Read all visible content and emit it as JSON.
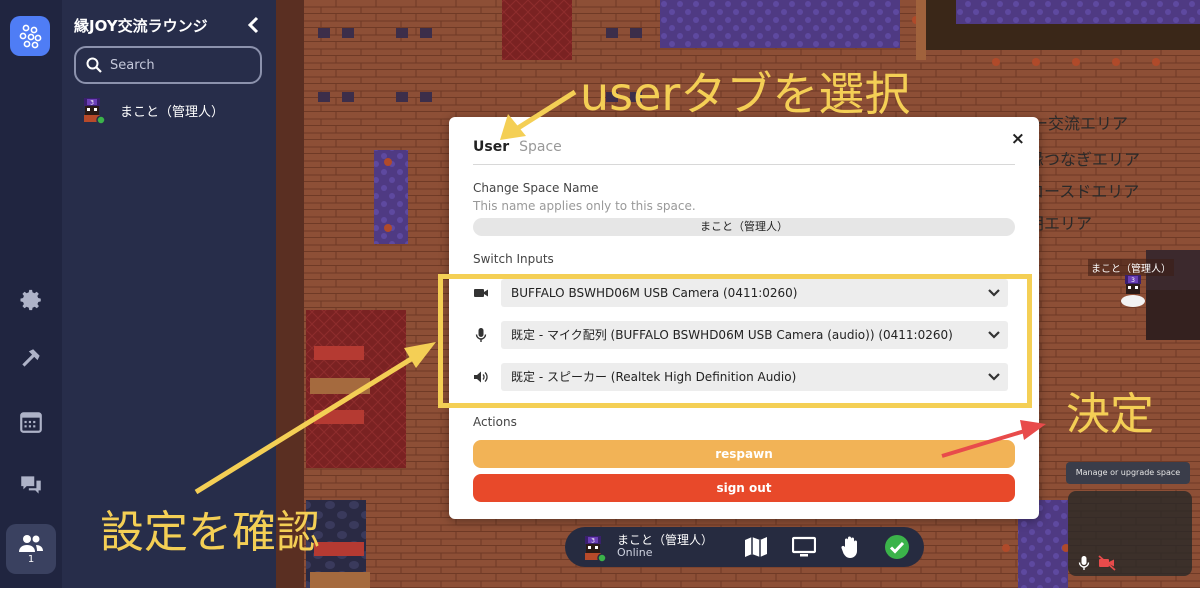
{
  "sidebar": {
    "title": "縁JOY交流ラウンジ",
    "search_placeholder": "Search",
    "user_name": "まこと（管理人）"
  },
  "rail": {
    "participants_count": "1"
  },
  "game": {
    "room_labels": [
      "リー交流エリア",
      "縁つなぎエリア",
      "ロースドエリア",
      "朗エリア"
    ],
    "character_label": "まこと（管理人）",
    "manage_tip": "Manage or upgrade space"
  },
  "modal": {
    "tabs": [
      "User",
      "Space"
    ],
    "close_label": "×",
    "change_name_label": "Change Space Name",
    "change_name_note": "This name applies only to this space.",
    "name_value": "まこと（管理人）",
    "switch_inputs_label": "Switch Inputs",
    "inputs": {
      "camera": "BUFFALO BSWHD06M USB Camera (0411:0260)",
      "mic": "既定 - マイク配列 (BUFFALO BSWHD06M USB Camera (audio)) (0411:0260)",
      "speaker": "既定 - スピーカー (Realtek High Definition Audio)"
    },
    "actions_label": "Actions",
    "respawn_label": "respawn",
    "signout_label": "sign out"
  },
  "dock": {
    "name": "まこと（管理人）",
    "status": "Online"
  },
  "annotations": {
    "select_user_tab": "userタブを選択",
    "check_settings": "設定を確認",
    "decide": "決定"
  },
  "colors": {
    "annotation_yellow": "#f4cf55",
    "annotation_red": "#e84b4b",
    "respawn": "#f2b356",
    "signout": "#e8492a",
    "rail": "#202540",
    "sidebar": "#272d4a",
    "online": "#3bb34a"
  },
  "icons": {
    "rail": [
      "logo-icon",
      "gear-icon",
      "hammer-icon",
      "calendar-icon",
      "chat-icon",
      "people-icon"
    ],
    "inputs": [
      "camera-icon",
      "microphone-icon",
      "speaker-icon"
    ],
    "dock": [
      "map-icon",
      "screen-share-icon",
      "hand-raise-icon",
      "check-status-icon"
    ]
  }
}
